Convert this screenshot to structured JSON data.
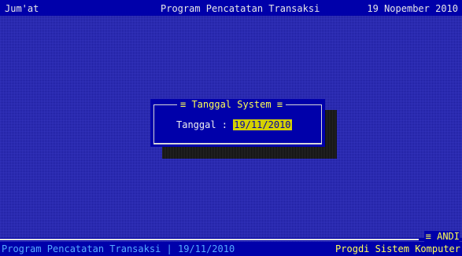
{
  "header": {
    "day": "Jum'at",
    "title": "Program Pencatatan Transaksi",
    "date": "19 Nopember 2010"
  },
  "dialog": {
    "title": "≡ Tanggal System ≡",
    "field_label": "Tanggal :",
    "field_value": "19/11/2010"
  },
  "status": {
    "user": "≡ ANDI",
    "left_text": "Program Pencatatan Transaksi | 19/11/2010",
    "right_text": "Progdi Sistem Komputer"
  },
  "colors": {
    "background": "#1a1a9a",
    "bar": "#0000aa",
    "highlight": "#ffff55",
    "input_bg": "#d4d000"
  }
}
